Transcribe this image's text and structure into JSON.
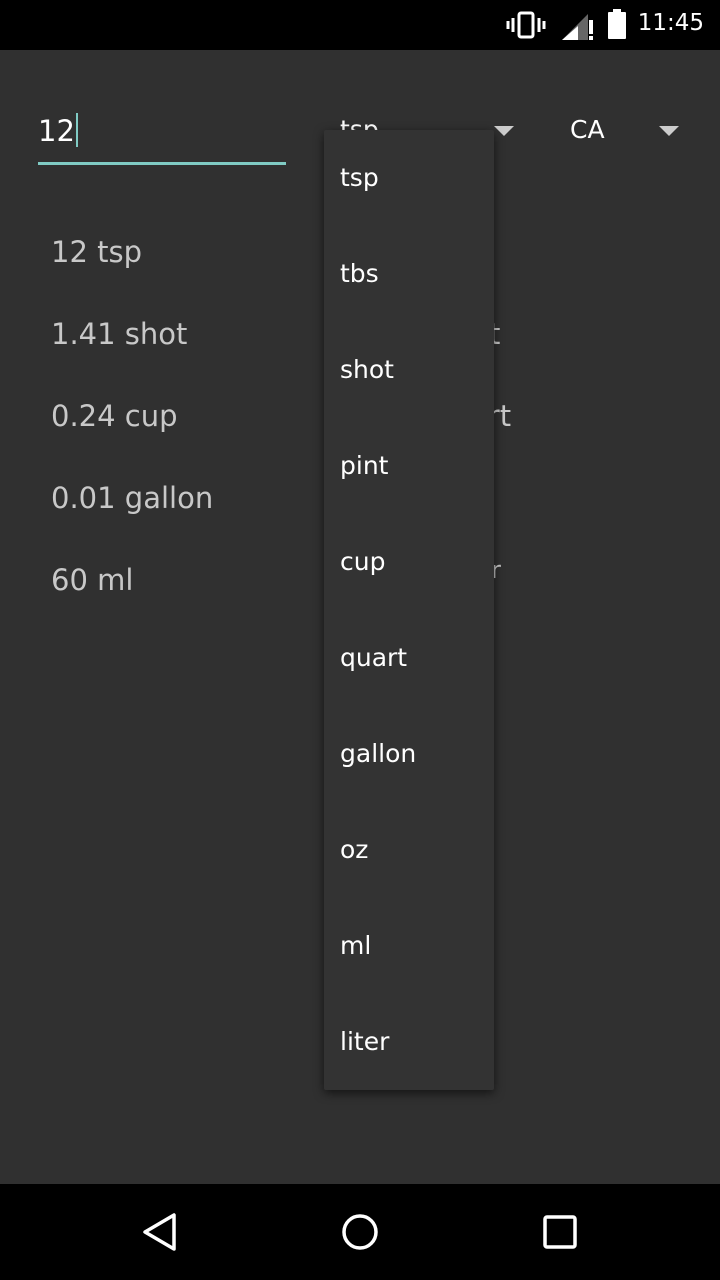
{
  "status_bar": {
    "time": "11:45",
    "icons": [
      "vibrate-icon",
      "signal-icon",
      "battery-icon"
    ]
  },
  "converter": {
    "amount_value": "12",
    "from_unit": "tsp",
    "to_unit": "CA"
  },
  "results": [
    "12 tsp",
    "1.41 shot",
    "0.24 cup",
    "0.01 gallon",
    "60 ml"
  ],
  "partial_results_right": [
    "t",
    "art",
    "r"
  ],
  "dropdown": {
    "items": [
      "tsp",
      "tbs",
      "shot",
      "pint",
      "cup",
      "quart",
      "gallon",
      "oz",
      "ml",
      "liter"
    ]
  },
  "navigation": {
    "icons": [
      "back-icon",
      "home-icon",
      "recents-icon"
    ]
  },
  "colors": {
    "accent": "#80cbc4",
    "background": "#303030",
    "popup": "#333333"
  }
}
